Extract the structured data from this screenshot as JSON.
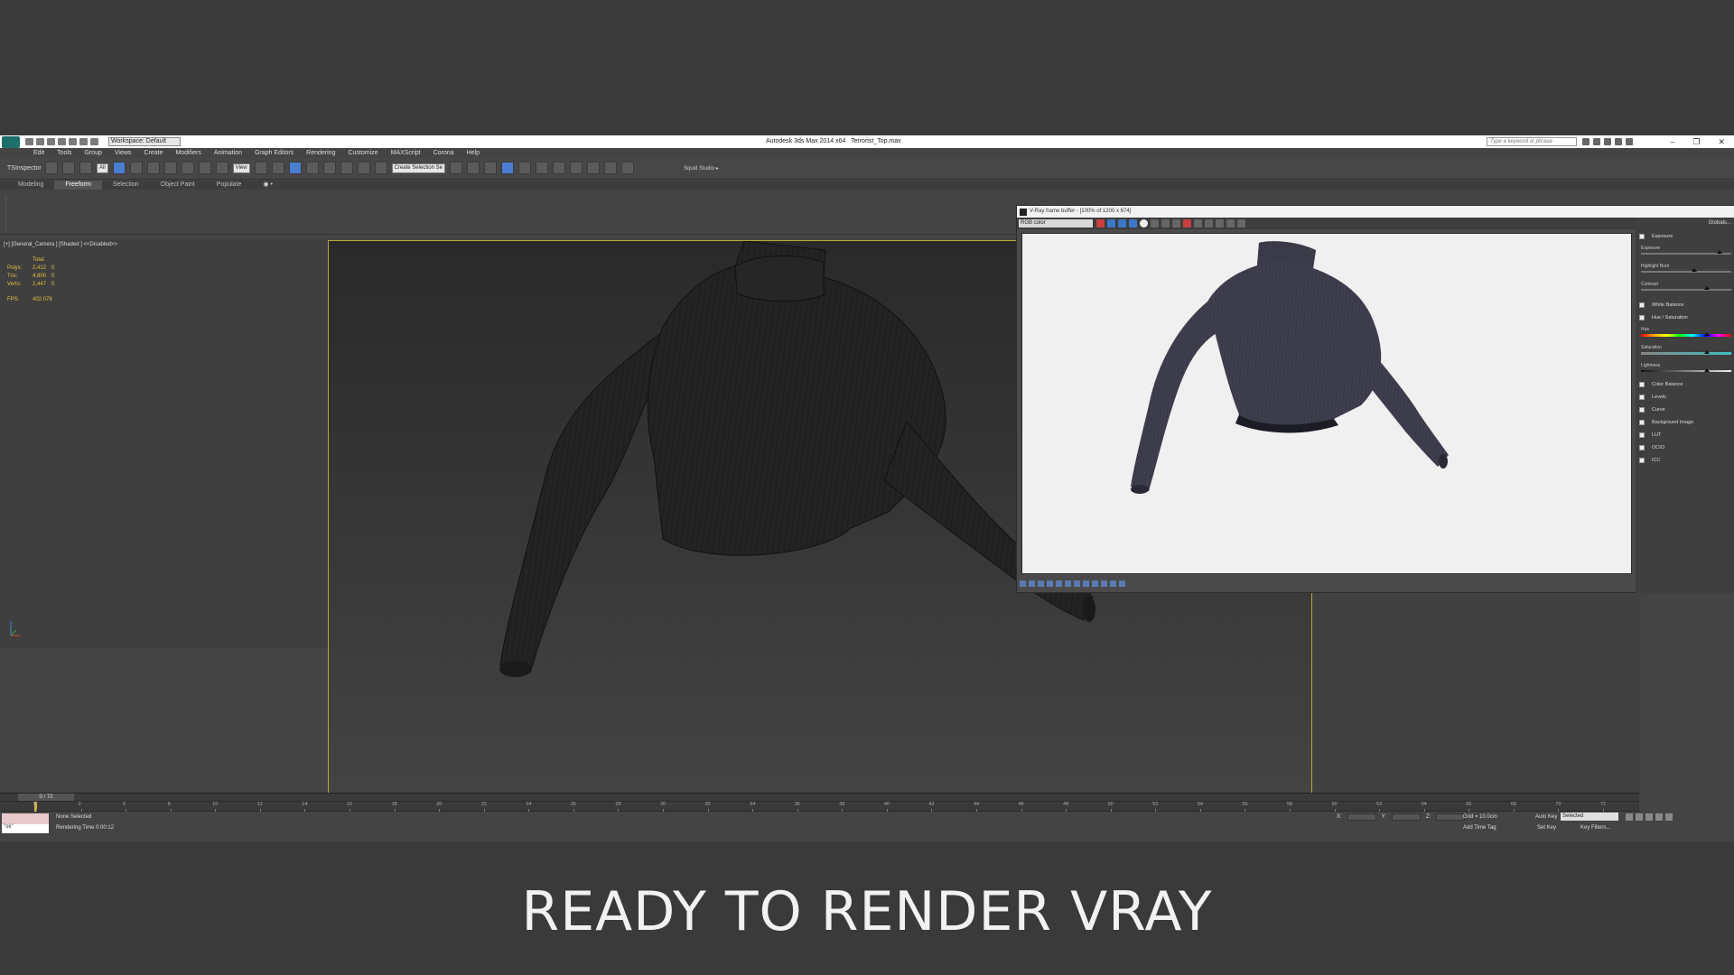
{
  "app": {
    "title": "Autodesk 3ds Max  2014 x64",
    "filename": "Terrorist_Top.max",
    "workspace": "Workspace: Default",
    "search_placeholder": "Type a keyword or phrase",
    "window_controls": [
      "–",
      "❐",
      "✕"
    ]
  },
  "menu": [
    "Edit",
    "Tools",
    "Group",
    "Views",
    "Create",
    "Modifiers",
    "Animation",
    "Graph Editors",
    "Rendering",
    "Customize",
    "MAXScript",
    "Corona",
    "Help"
  ],
  "toolbar": {
    "ts_inspector": "TSInspector",
    "filter_dropdown": "All",
    "view_dropdown": "View",
    "create_selection": "Create Selection Se",
    "squid_studio": "Squid Studio ▸"
  },
  "ribbon": {
    "tabs": [
      "Modeling",
      "Freeform",
      "Selection",
      "Object Paint",
      "Populate"
    ],
    "active_tab": "Freeform",
    "toggle_glyph": "◉ •"
  },
  "viewport": {
    "label": "[+] [General_Camera ] [Shaded ]  <<Disabled>>",
    "stats": {
      "total_label": "Total",
      "polys_label": "Polys:",
      "polys_value": "2,412",
      "polys_sel": "0",
      "tris_label": "Tris:",
      "tris_value": "4,800",
      "tris_sel": "0",
      "verts_label": "Verts:",
      "verts_value": "2,447",
      "verts_sel": "0",
      "fps_label": "FPS:",
      "fps_value": "402.076"
    }
  },
  "vfb": {
    "title": "V-Ray frame buffer - [100% of 1200 x 674]",
    "channel": "RGB color",
    "globals": "Globals...",
    "panel": {
      "exposure": "Exposure",
      "exposure_slider": "Exposure",
      "highlight_burn": "Highlight Burn",
      "contrast": "Contrast",
      "white_balance": "White Balance",
      "hue_saturation": "Hue / Saturation",
      "hue": "Hue",
      "saturation": "Saturation",
      "lightness": "Lightness",
      "color_balance": "Color Balance",
      "levels": "Levels",
      "curve": "Curve",
      "background_image": "Background Image",
      "lut": "LUT",
      "ocio": "OCIO",
      "icc": "ICC"
    }
  },
  "timeline": {
    "frame": "0 / 72",
    "ticks": [
      "0",
      "2",
      "6",
      "8",
      "10",
      "12",
      "14",
      "16",
      "18",
      "20",
      "22",
      "24",
      "26",
      "28",
      "30",
      "32",
      "34",
      "36",
      "38",
      "40",
      "42",
      "44",
      "46",
      "48",
      "50",
      "52",
      "54",
      "56",
      "58",
      "60",
      "62",
      "64",
      "66",
      "68",
      "70",
      "72"
    ]
  },
  "status": {
    "script_box": "\"ok\"",
    "selection": "None Selected",
    "render_time": "Rendering Time  0:00:12",
    "x_label": "X:",
    "y_label": "Y:",
    "z_label": "Z:",
    "grid": "Grid = 10.0cm",
    "add_time_tag": "Add Time Tag",
    "auto_key": "Auto Key",
    "set_key": "Set Key",
    "selected": "Selected",
    "key_filters": "Key Filters..."
  },
  "caption": "READY TO RENDER VRAY",
  "colors": {
    "background": "#3a3a3a",
    "viewport_border": "#b6a93a",
    "stats_text": "#e0c040",
    "sweater_render": "#3a3a4a",
    "sweater_viewport": "#1f1f1f"
  }
}
